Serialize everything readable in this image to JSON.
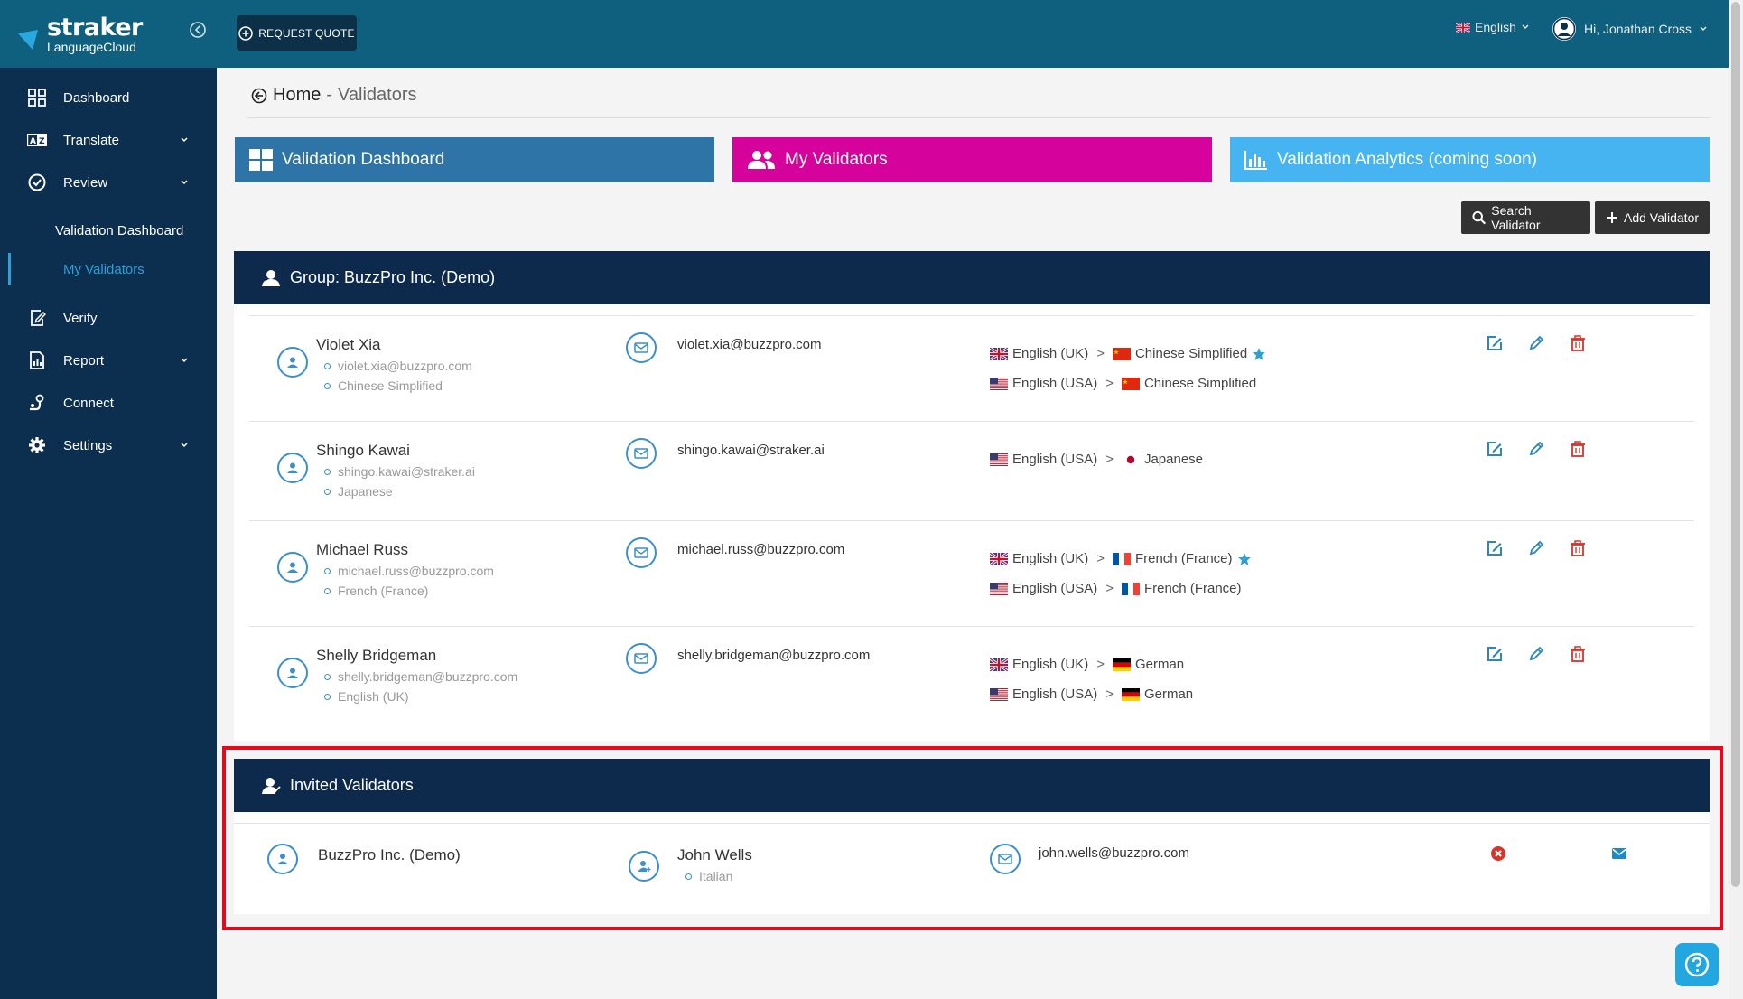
{
  "header": {
    "logo_main": "straker",
    "logo_sub": "LanguageCloud",
    "request_quote": "REQUEST QUOTE",
    "language": "English",
    "user_greeting": "Hi, Jonathan Cross"
  },
  "sidebar": {
    "items": [
      {
        "label": "Dashboard",
        "icon": "grid-icon"
      },
      {
        "label": "Translate",
        "icon": "translate-icon"
      },
      {
        "label": "Review",
        "icon": "check-circle-icon"
      },
      {
        "label": "Verify",
        "icon": "document-edit-icon"
      },
      {
        "label": "Report",
        "icon": "report-icon"
      },
      {
        "label": "Connect",
        "icon": "connect-icon"
      },
      {
        "label": "Settings",
        "icon": "gear-icon"
      }
    ],
    "sub_items": [
      {
        "label": "Validation Dashboard"
      },
      {
        "label": "My Validators",
        "active": true
      }
    ]
  },
  "breadcrumb": {
    "home": "Home",
    "sep": "-",
    "current": "Validators"
  },
  "tabs": [
    {
      "label": "Validation Dashboard",
      "color": "#2e74a6"
    },
    {
      "label": "My Validators",
      "color": "#d5039b"
    },
    {
      "label": "Validation Analytics (coming soon)",
      "color": "#46b4f0"
    }
  ],
  "actions": {
    "search": "Search Validator",
    "add": "Add Validator"
  },
  "group": {
    "title": "Group: BuzzPro Inc. (Demo)",
    "validators": [
      {
        "name": "Violet Xia",
        "email": "violet.xia@buzzpro.com",
        "language": "Chinese Simplified",
        "pairs": [
          {
            "source": "English (UK)",
            "target": "Chinese Simplified",
            "starred": true
          },
          {
            "source": "English (USA)",
            "target": "Chinese Simplified",
            "starred": false
          }
        ]
      },
      {
        "name": "Shingo Kawai",
        "email": "shingo.kawai@straker.ai",
        "language": "Japanese",
        "pairs": [
          {
            "source": "English (USA)",
            "target": "Japanese",
            "starred": false
          }
        ]
      },
      {
        "name": "Michael Russ",
        "email": "michael.russ@buzzpro.com",
        "language": "French (France)",
        "pairs": [
          {
            "source": "English (UK)",
            "target": "French (France)",
            "starred": true
          },
          {
            "source": "English (USA)",
            "target": "French (France)",
            "starred": false
          }
        ]
      },
      {
        "name": "Shelly Bridgeman",
        "email": "shelly.bridgeman@buzzpro.com",
        "language": "English (UK)",
        "pairs": [
          {
            "source": "English (UK)",
            "target": "German",
            "starred": false
          },
          {
            "source": "English (USA)",
            "target": "German",
            "starred": false
          }
        ]
      }
    ]
  },
  "invited": {
    "title": "Invited Validators",
    "rows": [
      {
        "group": "BuzzPro Inc. (Demo)",
        "name": "John Wells",
        "language": "Italian",
        "email": "john.wells@buzzpro.com"
      }
    ]
  },
  "colors": {
    "topbar": "#0f5f7e",
    "sidebar": "#0c2f50",
    "header_dark": "#0d2a4d",
    "accent_blue": "#2f9fd8",
    "delete_red": "#d9342b",
    "highlight": "#e40a1c"
  }
}
